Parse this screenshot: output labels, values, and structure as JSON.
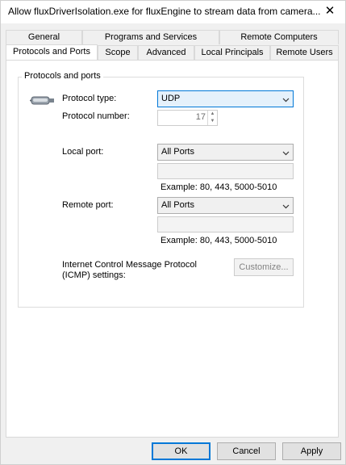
{
  "window": {
    "title": "Allow fluxDriverIsolation.exe for fluxEngine to stream data from camera..."
  },
  "tabs": {
    "row_top": [
      "General",
      "Programs and Services",
      "Remote Computers"
    ],
    "row_bottom": [
      "Protocols and Ports",
      "Scope",
      "Advanced",
      "Local Principals",
      "Remote Users"
    ],
    "active": "Protocols and Ports"
  },
  "protocols": {
    "group_label": "Protocols and ports",
    "protocol_type_label": "Protocol type:",
    "protocol_type_value": "UDP",
    "protocol_number_label": "Protocol number:",
    "protocol_number_value": "17",
    "local_port_label": "Local port:",
    "local_port_value": "All Ports",
    "local_port_example": "Example: 80, 443, 5000-5010",
    "remote_port_label": "Remote port:",
    "remote_port_value": "All Ports",
    "remote_port_example": "Example: 80, 443, 5000-5010",
    "icmp_label_line1": "Internet Control Message Protocol",
    "icmp_label_line2": "(ICMP) settings:",
    "customize_label": "Customize..."
  },
  "footer": {
    "ok_label": "OK",
    "cancel_label": "Cancel",
    "apply_label": "Apply"
  },
  "colors": {
    "accent": "#0078d7",
    "dialog_bg": "#f0f0f0",
    "panel_bg": "#ffffff"
  },
  "icons": {
    "close": "close-icon",
    "protocol": "network-plug-icon",
    "dropdown": "chevron-down-icon"
  }
}
